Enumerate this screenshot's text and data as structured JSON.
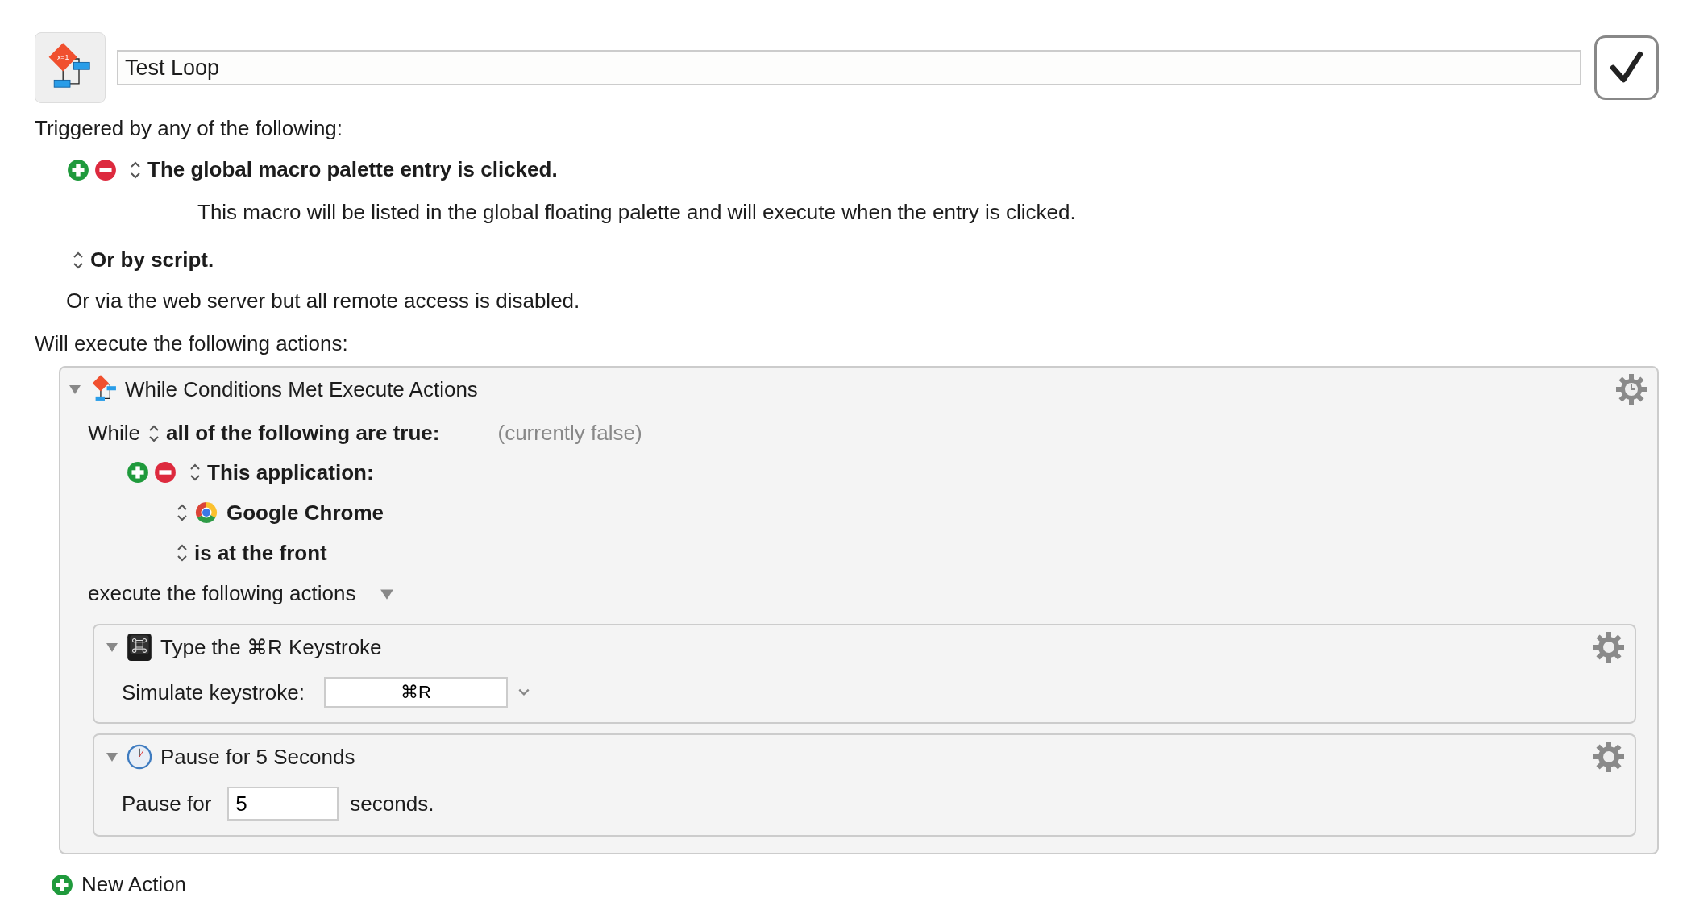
{
  "macro": {
    "title": "Test Loop",
    "enabled": true,
    "icon_label": "x=1"
  },
  "triggers_heading": "Triggered by any of the following:",
  "triggers": [
    {
      "label": "The global macro palette entry is clicked.",
      "description": "This macro will be listed in the global floating palette and will execute when the entry is clicked."
    }
  ],
  "script_trigger": "Or by script.",
  "web_server_note": "Or via the web server but all remote access is disabled.",
  "actions_heading": "Will execute the following actions:",
  "while_action": {
    "title": "While Conditions Met Execute Actions",
    "expanded": true,
    "while_label": "While",
    "match": "all of the following are true:",
    "status": "(currently false)",
    "conditions": [
      {
        "application_label": "This application:",
        "application": "Google Chrome",
        "state": "is at the front"
      }
    ],
    "execute_label": "execute the following actions",
    "actions": [
      {
        "kind": "keystroke",
        "title": "Type the ⌘R Keystroke",
        "expanded": true,
        "label": "Simulate keystroke:",
        "value": "⌘R"
      },
      {
        "kind": "pause",
        "title": "Pause for 5 Seconds",
        "expanded": true,
        "label": "Pause for",
        "value": "5",
        "suffix": "seconds."
      }
    ]
  },
  "new_action": "New Action"
}
